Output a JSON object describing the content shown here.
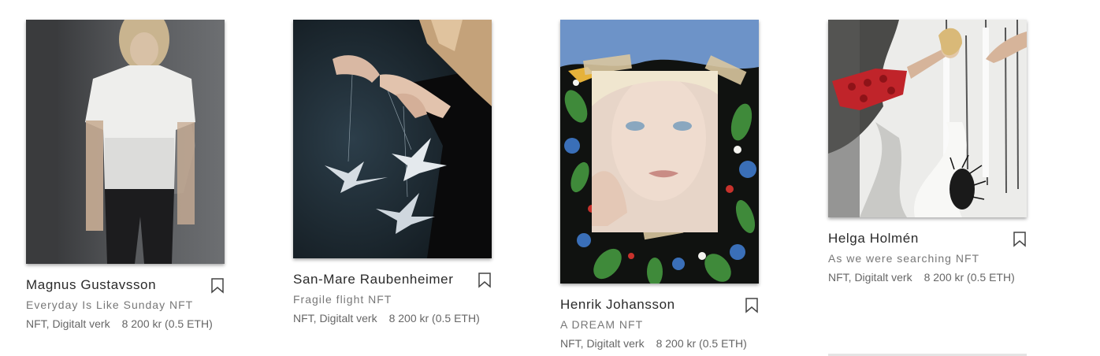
{
  "artworks": [
    {
      "artist": "Magnus Gustavsson",
      "title": "Everyday Is Like Sunday NFT",
      "category": "NFT, Digitalt verk",
      "price": "8 200 kr (0.5 ETH)",
      "image": "painting-woman-white-tshirt",
      "bookmark_icon": "bookmark-icon"
    },
    {
      "artist": "San-Mare Raubenheimer",
      "title": "Fragile flight NFT",
      "category": "NFT, Digitalt verk",
      "price": "8 200 kr (0.5 ETH)",
      "image": "painting-hands-origami-cranes",
      "bookmark_icon": "bookmark-icon"
    },
    {
      "artist": "Henrik Johansson",
      "title": "A DREAM NFT",
      "category": "NFT, Digitalt verk",
      "price": "8 200 kr (0.5 ETH)",
      "image": "painting-face-floral-pattern",
      "bookmark_icon": "bookmark-icon"
    },
    {
      "artist": "Helga Holmén",
      "title": "As we were searching NFT",
      "category": "NFT, Digitalt verk",
      "price": "8 200 kr (0.5 ETH)",
      "image": "drawing-girl-red-dress-forest",
      "bookmark_icon": "bookmark-icon"
    }
  ]
}
